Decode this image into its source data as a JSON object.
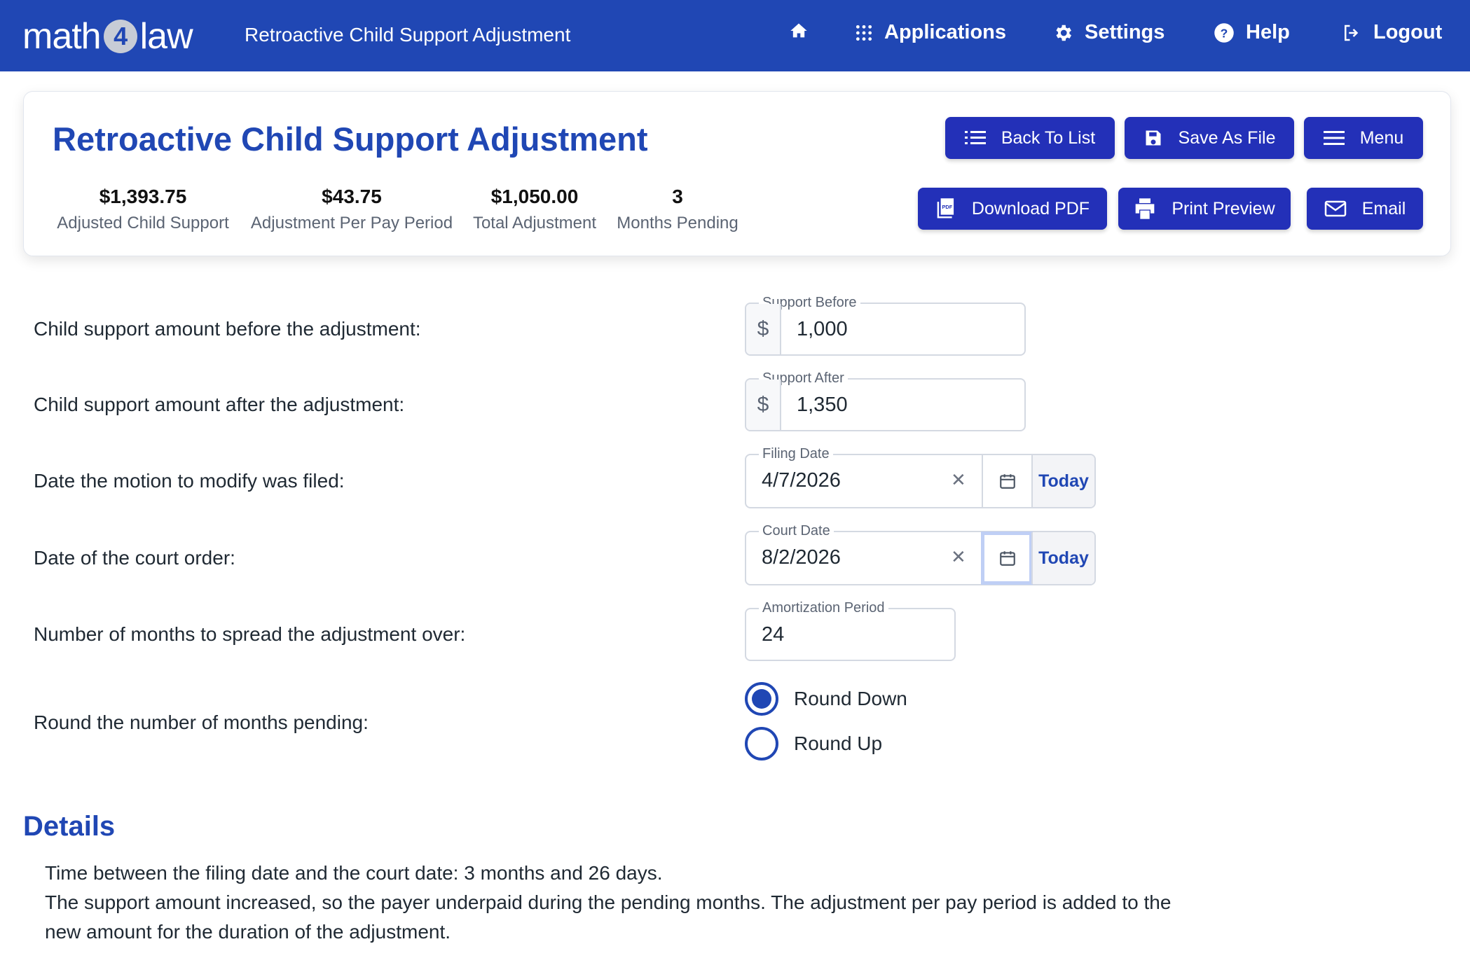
{
  "header": {
    "logo_left": "math",
    "logo_num": "4",
    "logo_right": "law",
    "app_title": "Retroactive Child Support Adjustment",
    "nav": {
      "applications": "Applications",
      "settings": "Settings",
      "help": "Help",
      "logout": "Logout"
    }
  },
  "card": {
    "title": "Retroactive Child Support Adjustment",
    "stats": [
      {
        "value": "$1,393.75",
        "label": "Adjusted Child Support"
      },
      {
        "value": "$43.75",
        "label": "Adjustment Per Pay Period"
      },
      {
        "value": "$1,050.00",
        "label": "Total Adjustment"
      },
      {
        "value": "3",
        "label": "Months Pending"
      }
    ],
    "buttons": {
      "back": "Back To List",
      "save": "Save As File",
      "menu": "Menu",
      "pdf": "Download PDF",
      "print": "Print Preview",
      "email": "Email"
    }
  },
  "form": {
    "support_before": {
      "label": "Child support amount before the adjustment:",
      "legend": "Support Before",
      "prefix": "$",
      "value": "1,000"
    },
    "support_after": {
      "label": "Child support amount after the adjustment:",
      "legend": "Support After",
      "prefix": "$",
      "value": "1,350"
    },
    "filing_date": {
      "label": "Date the motion to modify was filed:",
      "legend": "Filing Date",
      "value": "4/7/2026",
      "today": "Today"
    },
    "court_date": {
      "label": "Date of the court order:",
      "legend": "Court Date",
      "value": "8/2/2026",
      "today": "Today"
    },
    "amortization": {
      "label": "Number of months to spread the adjustment over:",
      "legend": "Amortization Period",
      "value": "24"
    },
    "rounding": {
      "label": "Round the number of months pending:",
      "options": [
        "Round Down",
        "Round Up"
      ],
      "selected": "Round Down"
    }
  },
  "details": {
    "title": "Details",
    "line1": "Time between the filing date and the court date: 3 months and 26 days.",
    "line2": "The support amount increased, so the payer underpaid during the pending months. The adjustment per pay period is added to the new amount for the duration of the adjustment."
  },
  "colors": {
    "brand": "#2047b4",
    "button": "#2330b8"
  }
}
